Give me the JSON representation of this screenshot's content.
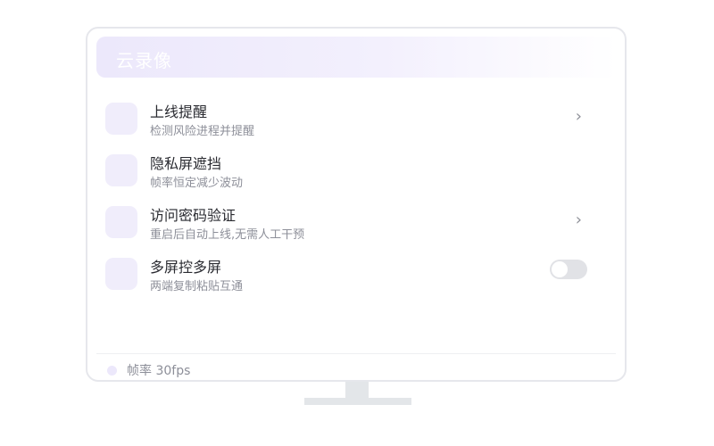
{
  "header": {
    "title": "云录像"
  },
  "settings": [
    {
      "title": "上线提醒",
      "subtitle": "检测风险进程并提醒",
      "control": "chevron",
      "chevron": "›"
    },
    {
      "title": "隐私屏遮挡",
      "subtitle": "帧率恒定减少波动",
      "control": "none"
    },
    {
      "title": "访问密码验证",
      "subtitle": "重启后自动上线,无需人工干预",
      "control": "chevron",
      "chevron": "›"
    },
    {
      "title": "多屏控多屏",
      "subtitle": "两端复制粘贴互通",
      "control": "toggle",
      "toggle_on": false
    }
  ],
  "footer": {
    "status": "帧率 30fps"
  },
  "colors": {
    "accent": "#ece8fb",
    "icon_bg": "#f0edfb",
    "toggle_off": "#e1e2e6",
    "title_text": "#2a2b31",
    "sub_text": "#8d8f99"
  }
}
